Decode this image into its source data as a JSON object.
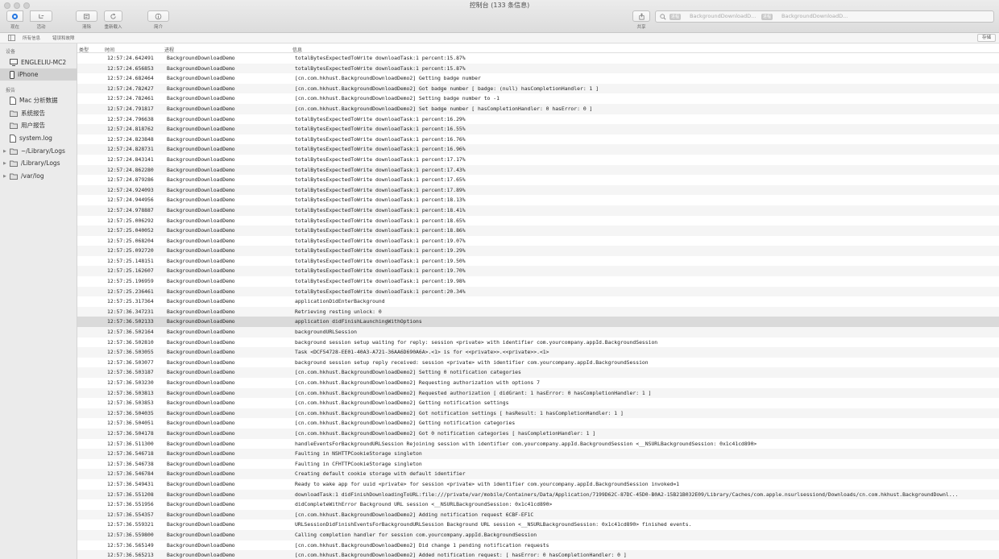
{
  "window": {
    "title": "控制台 (133 条信息)"
  },
  "toolbar": {
    "now_label": "现在",
    "activity_label": "活动",
    "clear_label": "清除",
    "reload_label": "重新载入",
    "info_label": "简介",
    "share_label": "共享"
  },
  "search": {
    "chip1": "进程",
    "text1": "BackgroundDownloadD...",
    "chip2": "进程",
    "text2": "BackgroundDownloadD..."
  },
  "filterbar": {
    "all_messages": "所有信息",
    "errors_faults": "错误和故障",
    "save": "存储"
  },
  "sidebar": {
    "devices_header": "设备",
    "devices": [
      "ENGLELIU-MC2",
      "iPhone"
    ],
    "reports_header": "报告",
    "reports": [
      "Mac 分析数据",
      "系统报告",
      "用户报告",
      "system.log",
      "~/Library/Logs",
      "/Library/Logs",
      "/var/log"
    ]
  },
  "table": {
    "columns": {
      "type": "类型",
      "time": "时间",
      "process": "进程",
      "message": "信息"
    },
    "selected_index": 26,
    "rows": [
      {
        "time": "12:57:24.642491",
        "process": "BackgroundDownloadDemo",
        "message": "totalBytesExpectedToWrite downloadTask:1 percent:15.87%"
      },
      {
        "time": "12:57:24.656853",
        "process": "BackgroundDownloadDemo",
        "message": "totalBytesExpectedToWrite downloadTask:1 percent:15.87%"
      },
      {
        "time": "12:57:24.682464",
        "process": "BackgroundDownloadDemo",
        "message": "[cn.com.hkhust.BackgroundDownloadDemo2] Getting badge number"
      },
      {
        "time": "12:57:24.782427",
        "process": "BackgroundDownloadDemo",
        "message": "[cn.com.hkhust.BackgroundDownloadDemo2] Got badge number [ badge: (null) hasCompletionHandler: 1 ]"
      },
      {
        "time": "12:57:24.782461",
        "process": "BackgroundDownloadDemo",
        "message": "[cn.com.hkhust.BackgroundDownloadDemo2] Setting badge number to -1"
      },
      {
        "time": "12:57:24.791817",
        "process": "BackgroundDownloadDemo",
        "message": "[cn.com.hkhust.BackgroundDownloadDemo2] Set badge number [ hasCompletionHandler: 0 hasError: 0 ]"
      },
      {
        "time": "12:57:24.796638",
        "process": "BackgroundDownloadDemo",
        "message": "totalBytesExpectedToWrite downloadTask:1 percent:16.29%"
      },
      {
        "time": "12:57:24.818762",
        "process": "BackgroundDownloadDemo",
        "message": "totalBytesExpectedToWrite downloadTask:1 percent:16.55%"
      },
      {
        "time": "12:57:24.823848",
        "process": "BackgroundDownloadDemo",
        "message": "totalBytesExpectedToWrite downloadTask:1 percent:16.76%"
      },
      {
        "time": "12:57:24.828731",
        "process": "BackgroundDownloadDemo",
        "message": "totalBytesExpectedToWrite downloadTask:1 percent:16.96%"
      },
      {
        "time": "12:57:24.843141",
        "process": "BackgroundDownloadDemo",
        "message": "totalBytesExpectedToWrite downloadTask:1 percent:17.17%"
      },
      {
        "time": "12:57:24.862280",
        "process": "BackgroundDownloadDemo",
        "message": "totalBytesExpectedToWrite downloadTask:1 percent:17.43%"
      },
      {
        "time": "12:57:24.879286",
        "process": "BackgroundDownloadDemo",
        "message": "totalBytesExpectedToWrite downloadTask:1 percent:17.65%"
      },
      {
        "time": "12:57:24.924093",
        "process": "BackgroundDownloadDemo",
        "message": "totalBytesExpectedToWrite downloadTask:1 percent:17.89%"
      },
      {
        "time": "12:57:24.944956",
        "process": "BackgroundDownloadDemo",
        "message": "totalBytesExpectedToWrite downloadTask:1 percent:18.13%"
      },
      {
        "time": "12:57:24.978887",
        "process": "BackgroundDownloadDemo",
        "message": "totalBytesExpectedToWrite downloadTask:1 percent:18.41%"
      },
      {
        "time": "12:57:25.006292",
        "process": "BackgroundDownloadDemo",
        "message": "totalBytesExpectedToWrite downloadTask:1 percent:18.65%"
      },
      {
        "time": "12:57:25.040052",
        "process": "BackgroundDownloadDemo",
        "message": "totalBytesExpectedToWrite downloadTask:1 percent:18.86%"
      },
      {
        "time": "12:57:25.068204",
        "process": "BackgroundDownloadDemo",
        "message": "totalBytesExpectedToWrite downloadTask:1 percent:19.07%"
      },
      {
        "time": "12:57:25.092720",
        "process": "BackgroundDownloadDemo",
        "message": "totalBytesExpectedToWrite downloadTask:1 percent:19.29%"
      },
      {
        "time": "12:57:25.148151",
        "process": "BackgroundDownloadDemo",
        "message": "totalBytesExpectedToWrite downloadTask:1 percent:19.50%"
      },
      {
        "time": "12:57:25.162607",
        "process": "BackgroundDownloadDemo",
        "message": "totalBytesExpectedToWrite downloadTask:1 percent:19.70%"
      },
      {
        "time": "12:57:25.196959",
        "process": "BackgroundDownloadDemo",
        "message": "totalBytesExpectedToWrite downloadTask:1 percent:19.98%"
      },
      {
        "time": "12:57:25.236461",
        "process": "BackgroundDownloadDemo",
        "message": "totalBytesExpectedToWrite downloadTask:1 percent:20.34%"
      },
      {
        "time": "12:57:25.317364",
        "process": "BackgroundDownloadDemo",
        "message": "applicationDidEnterBackground"
      },
      {
        "time": "12:57:36.347231",
        "process": "BackgroundDownloadDemo",
        "message": "Retrieving resting unlock: 0"
      },
      {
        "time": "12:57:36.502133",
        "process": "BackgroundDownloadDemo",
        "message": "application didFinishLaunchingWithOptions"
      },
      {
        "time": "12:57:36.502164",
        "process": "BackgroundDownloadDemo",
        "message": "backgroundURLSession"
      },
      {
        "time": "12:57:36.502810",
        "process": "BackgroundDownloadDemo",
        "message": "background session setup waiting for reply: session <private> with identifier com.yourcompany.appId.BackgroundSession"
      },
      {
        "time": "12:57:36.503055",
        "process": "BackgroundDownloadDemo",
        "message": "Task <DCF54728-EE01-40A3-A721-36AA6D690A6A>.<1> is for <<private>>.<<private>>.<1>"
      },
      {
        "time": "12:57:36.503077",
        "process": "BackgroundDownloadDemo",
        "message": "background session setup reply received: session <private> with identifier com.yourcompany.appId.BackgroundSession"
      },
      {
        "time": "12:57:36.503187",
        "process": "BackgroundDownloadDemo",
        "message": "[cn.com.hkhust.BackgroundDownloadDemo2] Setting 0 notification categories"
      },
      {
        "time": "12:57:36.503230",
        "process": "BackgroundDownloadDemo",
        "message": "[cn.com.hkhust.BackgroundDownloadDemo2] Requesting authorization with options 7"
      },
      {
        "time": "12:57:36.503813",
        "process": "BackgroundDownloadDemo",
        "message": "[cn.com.hkhust.BackgroundDownloadDemo2] Requested authorization [ didGrant: 1 hasError: 0 hasCompletionHandler: 1 ]"
      },
      {
        "time": "12:57:36.503853",
        "process": "BackgroundDownloadDemo",
        "message": "[cn.com.hkhust.BackgroundDownloadDemo2] Getting notification settings"
      },
      {
        "time": "12:57:36.504035",
        "process": "BackgroundDownloadDemo",
        "message": "[cn.com.hkhust.BackgroundDownloadDemo2] Got notification settings [ hasResult: 1 hasCompletionHandler: 1 ]"
      },
      {
        "time": "12:57:36.504051",
        "process": "BackgroundDownloadDemo",
        "message": "[cn.com.hkhust.BackgroundDownloadDemo2] Getting notification categories"
      },
      {
        "time": "12:57:36.504178",
        "process": "BackgroundDownloadDemo",
        "message": "[cn.com.hkhust.BackgroundDownloadDemo2] Got 0 notification categories [ hasCompletionHandler: 1 ]"
      },
      {
        "time": "12:57:36.511300",
        "process": "BackgroundDownloadDemo",
        "message": "handleEventsForBackgroundURLSession Rejoining session with identifier com.yourcompany.appId.BackgroundSession <__NSURLBackgroundSession: 0x1c41cd890>"
      },
      {
        "time": "12:57:36.546718",
        "process": "BackgroundDownloadDemo",
        "message": "Faulting in NSHTTPCookieStorage singleton"
      },
      {
        "time": "12:57:36.546738",
        "process": "BackgroundDownloadDemo",
        "message": "Faulting in CFHTTPCookieStorage singleton"
      },
      {
        "time": "12:57:36.546784",
        "process": "BackgroundDownloadDemo",
        "message": "Creating default cookie storage with default identifier"
      },
      {
        "time": "12:57:36.549431",
        "process": "BackgroundDownloadDemo",
        "message": "Ready to wake app for uuid <private> for session <private> with identifier com.yourcompany.appId.BackgroundSession invoked=1"
      },
      {
        "time": "12:57:36.551208",
        "process": "BackgroundDownloadDemo",
        "message": "downloadTask:1 didFinishDownloadingToURL:file:///private/var/mobile/Containers/Data/Application/7199D62C-87DC-45D0-B0A2-15B21B032E09/Library/Caches/com.apple.nsurlsessiond/Downloads/cn.com.hkhust.BackgroundDownl..."
      },
      {
        "time": "12:57:36.551956",
        "process": "BackgroundDownloadDemo",
        "message": "didCompleteWithError Background URL session <__NSURLBackgroundSession: 0x1c41cd890>"
      },
      {
        "time": "12:57:36.554357",
        "process": "BackgroundDownloadDemo",
        "message": "[cn.com.hkhust.BackgroundDownloadDemo2] Adding notification request 6CBF-EF1C"
      },
      {
        "time": "12:57:36.559321",
        "process": "BackgroundDownloadDemo",
        "message": "URLSessionDidFinishEventsForBackgroundURLSession Background URL session <__NSURLBackgroundSession: 0x1c41cd890> finished events."
      },
      {
        "time": "12:57:36.559800",
        "process": "BackgroundDownloadDemo",
        "message": "Calling completion handler for session com.yourcompany.appId.BackgroundSession"
      },
      {
        "time": "12:57:36.565149",
        "process": "BackgroundDownloadDemo",
        "message": "[cn.com.hkhust.BackgroundDownloadDemo2] Did change 1 pending notification requests"
      },
      {
        "time": "12:57:36.565213",
        "process": "BackgroundDownloadDemo",
        "message": "[cn.com.hkhust.BackgroundDownloadDemo2] Added notification request: [ hasError: 0 hasCompletionHandler: 0 ]"
      }
    ]
  }
}
